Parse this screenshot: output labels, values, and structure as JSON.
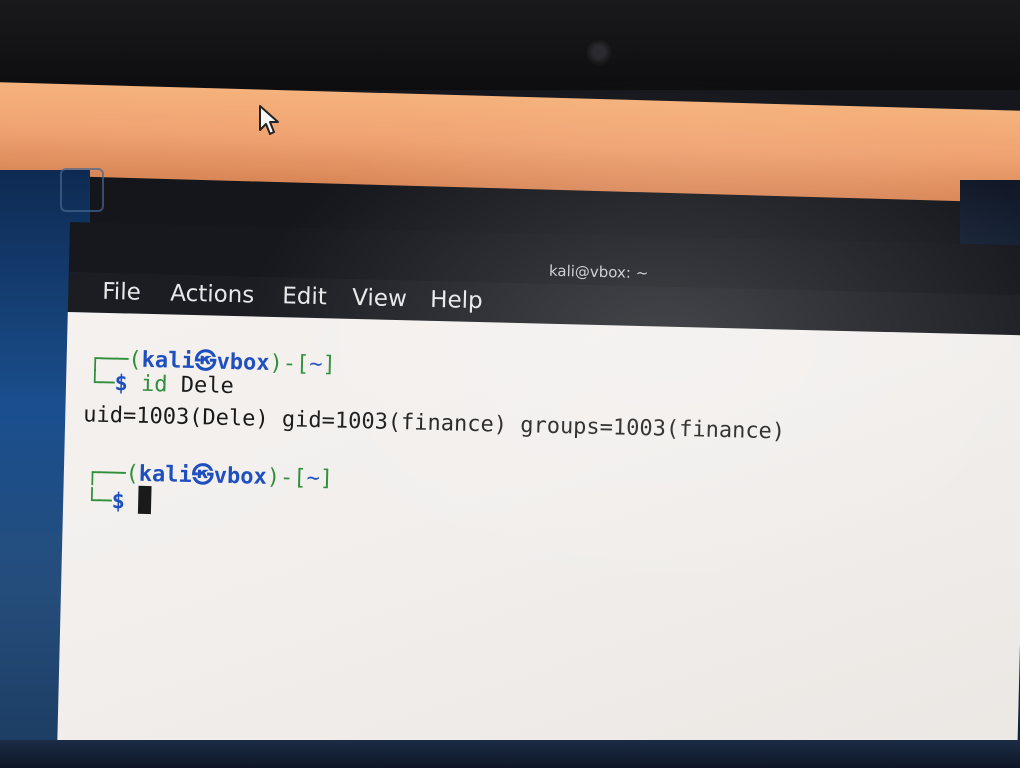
{
  "window": {
    "title": "kali@vbox: ~"
  },
  "menu": {
    "items": [
      "File",
      "Actions",
      "Edit",
      "View",
      "Help"
    ]
  },
  "terminal": {
    "prompt1": {
      "open": "┌──(",
      "user": "kali",
      "symbol": "㉿",
      "host": "vbox",
      "close_dir": ")-[",
      "dir": "~",
      "end": "]",
      "corner": "└─",
      "dollar": "$",
      "command_name": "id",
      "command_arg": "Dele"
    },
    "output_line": "uid=1003(Dele) gid=1003(finance) groups=1003(finance)",
    "prompt2": {
      "open": "┌──(",
      "user": "kali",
      "symbol": "㉿",
      "host": "vbox",
      "close_dir": ")-[",
      "dir": "~",
      "end": "]",
      "corner": "└─",
      "dollar": "$"
    }
  },
  "colors": {
    "panel": "#f0a372",
    "terminal_bg": "#f2efed",
    "prompt_blue": "#1f4fbf",
    "prompt_green": "#2f8f3a"
  }
}
